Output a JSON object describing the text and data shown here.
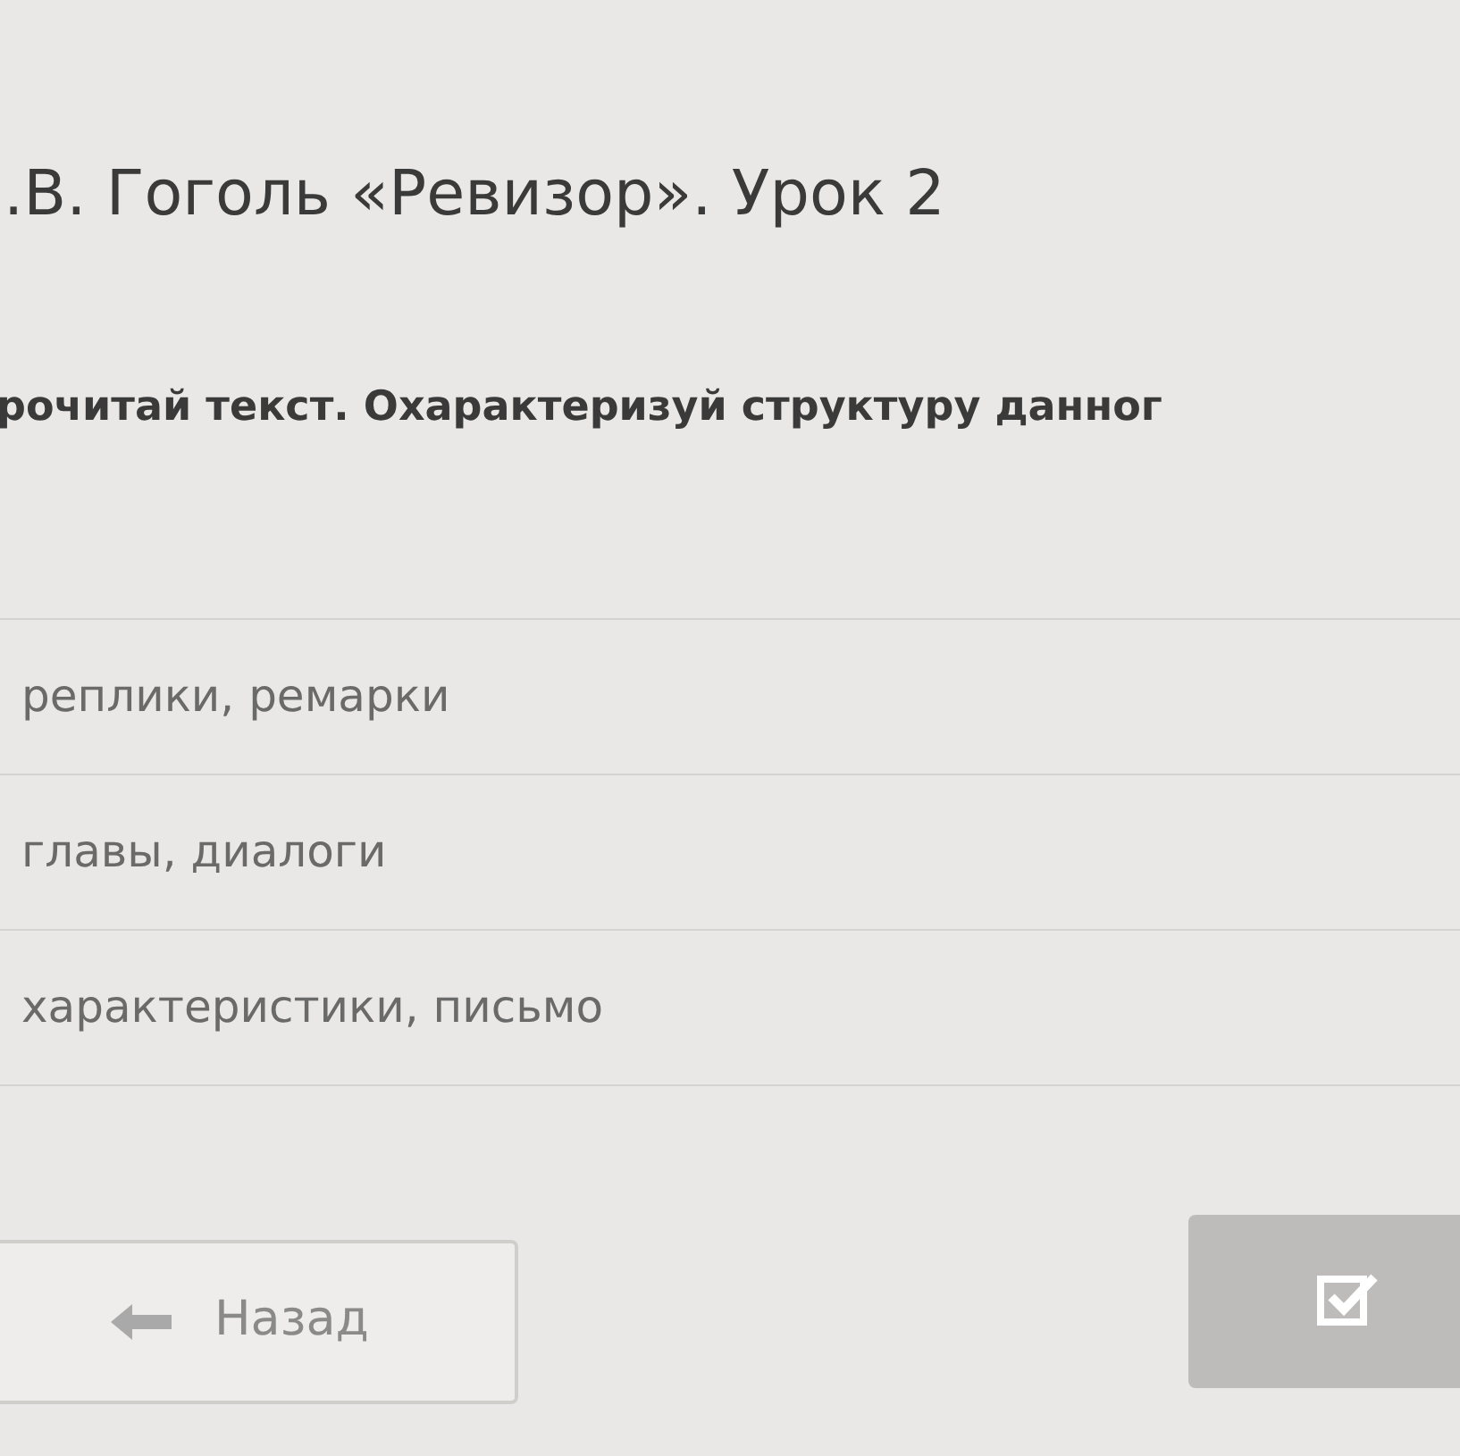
{
  "lesson_title": ".В. Гоголь «Ревизор». Урок 2",
  "question": "рочитай текст. Охарактеризуй структуру данног",
  "options": [
    {
      "label": "реплики, ремарки"
    },
    {
      "label": "главы, диалоги"
    },
    {
      "label": "характеристики, письмо"
    }
  ],
  "back_button": {
    "label": "Назад"
  }
}
